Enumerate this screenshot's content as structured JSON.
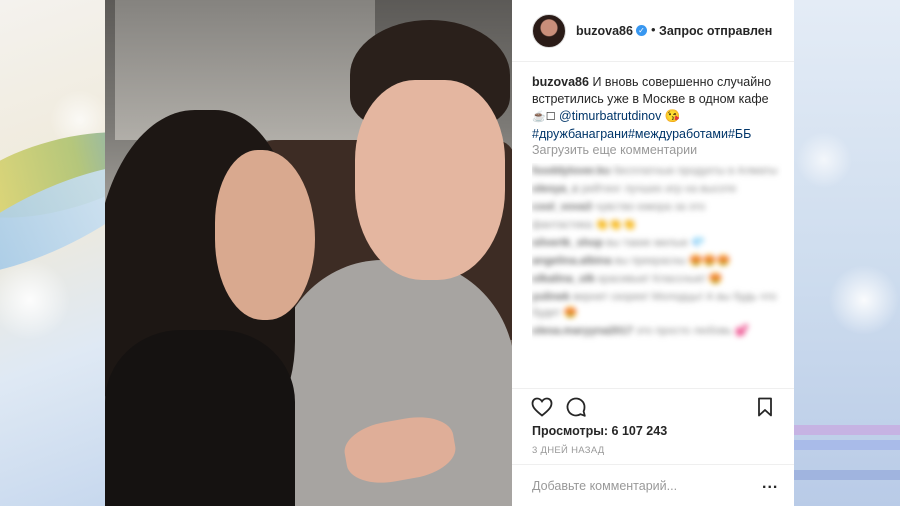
{
  "post": {
    "author": "buzova86",
    "verified_icon": "verified-badge-icon",
    "separator": "•",
    "follow_status": "Запрос отправлен",
    "caption": {
      "username": "buzova86",
      "text": "И вновь совершенно случайно встретились уже в Москве в одном кафе",
      "emoji": "☕☐",
      "mention": "@timurbatrutdinov",
      "mention_emoji": "😘",
      "hashtags": "#дружбанаграни#междуработами#ББ"
    },
    "load_more": "Загрузить еще комментарии",
    "comments": [
      {
        "user": "fooddylover.ku",
        "text": "бесплатные продукты в Алматы"
      },
      {
        "user": "olesya_c",
        "text": "рейтинг лучших игр на высоте"
      },
      {
        "user": "cool_vova3",
        "text": "чувство юмора за это"
      },
      {
        "user": "",
        "text": "фантастика 👏👏👏"
      },
      {
        "user": "silvertk_shop",
        "text": "вы такие милые 💎"
      },
      {
        "user": "angelina.albina",
        "text": "вы прекрасны 😍😍😍"
      },
      {
        "user": "olkalina_olk",
        "text": "красивые! Классные! 😍"
      },
      {
        "user": "yulinek",
        "text": "вернет скорее! Молодцы! А вы будь что будет 😍"
      },
      {
        "user": "olesa.maryyna2017",
        "text": "это просто любовь 💕"
      }
    ],
    "views_label": "Просмотры:",
    "views_count": "6 107 243",
    "timestamp": "3 ДНЕЙ НАЗАД",
    "comment_placeholder": "Добавьте комментарий...",
    "more_label": "...",
    "icons": {
      "like": "heart-icon",
      "comment": "comment-bubble-icon",
      "save": "bookmark-icon"
    }
  },
  "colors": {
    "link": "#003569",
    "muted": "#999999",
    "text": "#262626",
    "verified": "#3897f0"
  }
}
